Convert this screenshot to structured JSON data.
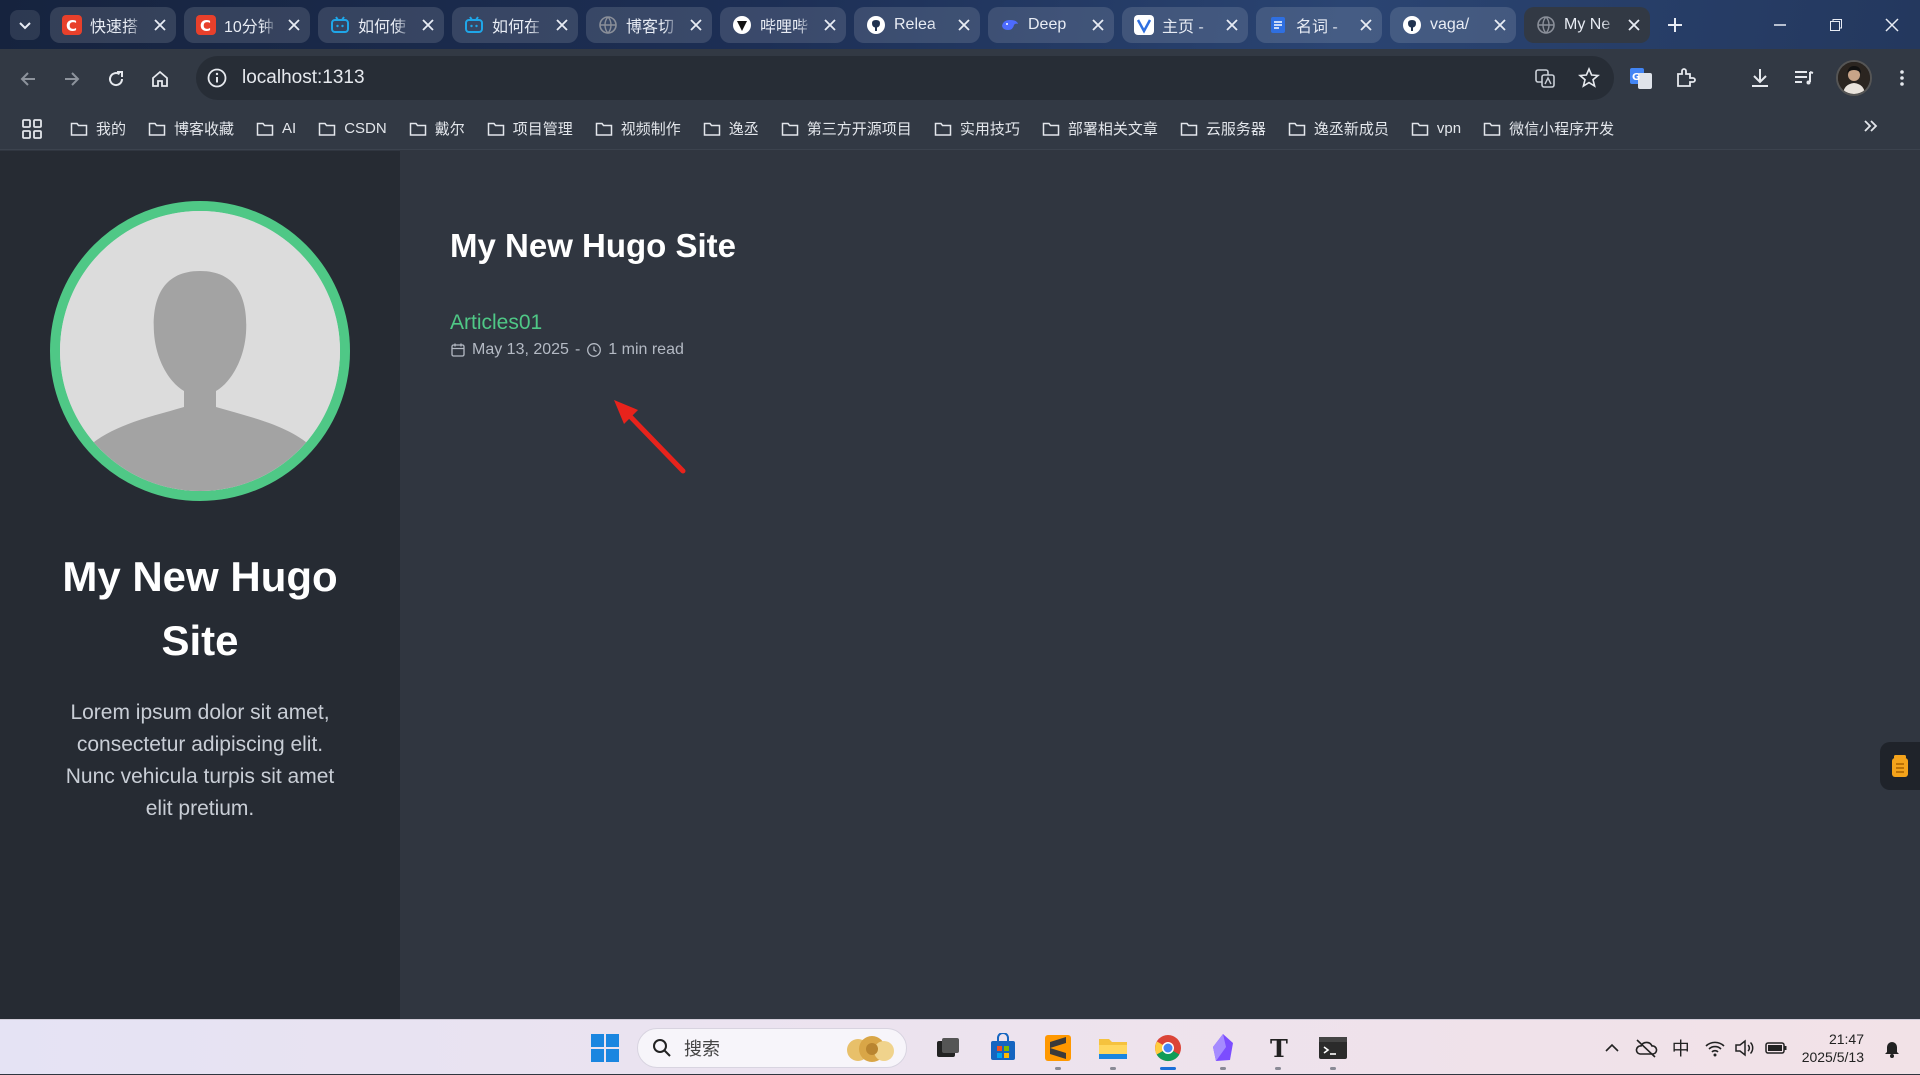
{
  "browser": {
    "tabs": [
      {
        "title": "快速搭",
        "favicon_color": "#e8402b",
        "favicon_glyph": "C",
        "active": false
      },
      {
        "title": "10分钟",
        "favicon_color": "#e8402b",
        "favicon_glyph": "C",
        "active": false
      },
      {
        "title": "如何使",
        "favicon_color": "#1fa6e8",
        "favicon_glyph": "tv",
        "active": false
      },
      {
        "title": "如何在",
        "favicon_color": "#1fa6e8",
        "favicon_glyph": "tv",
        "active": false
      },
      {
        "title": "博客切",
        "favicon_color": "#8a8f99",
        "favicon_glyph": "globe",
        "active": false
      },
      {
        "title": "哔哩哔",
        "favicon_color": "#111111",
        "favicon_glyph": "heart",
        "active": false
      },
      {
        "title": "Relea",
        "favicon_color": "#ffffff",
        "favicon_glyph": "github",
        "active": false
      },
      {
        "title": "Deep",
        "favicon_color": "#4d6bfe",
        "favicon_glyph": "whale",
        "active": false
      },
      {
        "title": "主页 -",
        "favicon_color": "#2f6fe0",
        "favicon_glyph": "flag",
        "active": false
      },
      {
        "title": "名词 -",
        "favicon_color": "#2f6fe0",
        "favicon_glyph": "doc",
        "active": false
      },
      {
        "title": "vaga/",
        "favicon_color": "#ffffff",
        "favicon_glyph": "github",
        "active": false
      },
      {
        "title": "My Ne",
        "favicon_color": "#8a8f99",
        "favicon_glyph": "globe",
        "active": true
      }
    ],
    "address": "localhost:1313",
    "bookmarks": [
      "我的",
      "博客收藏",
      "AI",
      "CSDN",
      "戴尔",
      "项目管理",
      "视频制作",
      "逸丞",
      "第三方开源项目",
      "实用技巧",
      "部署相关文章",
      "云服务器",
      "逸丞新成员",
      "vpn",
      "微信小程序开发"
    ]
  },
  "site": {
    "sidebar": {
      "title": "My New Hugo Site",
      "description": "Lorem ipsum dolor sit amet, consectetur adipiscing elit. Nunc vehicula turpis sit amet elit pretium."
    },
    "main": {
      "title": "My New Hugo Site",
      "posts": [
        {
          "title": "Articles01",
          "date": "May 13, 2025",
          "separator": "-",
          "read_time": "1 min read"
        }
      ]
    },
    "accent_color": "#4fc886"
  },
  "taskbar": {
    "search_placeholder": "搜索",
    "ime": "中",
    "time": "21:47",
    "date": "2025/5/13"
  }
}
